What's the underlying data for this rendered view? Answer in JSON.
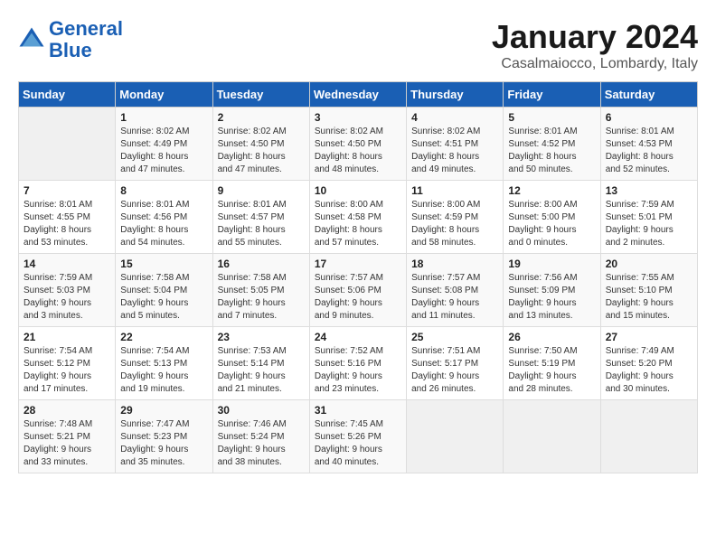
{
  "header": {
    "logo_line1": "General",
    "logo_line2": "Blue",
    "month": "January 2024",
    "location": "Casalmaiocco, Lombardy, Italy"
  },
  "weekdays": [
    "Sunday",
    "Monday",
    "Tuesday",
    "Wednesday",
    "Thursday",
    "Friday",
    "Saturday"
  ],
  "weeks": [
    [
      {
        "day": "",
        "info": ""
      },
      {
        "day": "1",
        "info": "Sunrise: 8:02 AM\nSunset: 4:49 PM\nDaylight: 8 hours\nand 47 minutes."
      },
      {
        "day": "2",
        "info": "Sunrise: 8:02 AM\nSunset: 4:50 PM\nDaylight: 8 hours\nand 47 minutes."
      },
      {
        "day": "3",
        "info": "Sunrise: 8:02 AM\nSunset: 4:50 PM\nDaylight: 8 hours\nand 48 minutes."
      },
      {
        "day": "4",
        "info": "Sunrise: 8:02 AM\nSunset: 4:51 PM\nDaylight: 8 hours\nand 49 minutes."
      },
      {
        "day": "5",
        "info": "Sunrise: 8:01 AM\nSunset: 4:52 PM\nDaylight: 8 hours\nand 50 minutes."
      },
      {
        "day": "6",
        "info": "Sunrise: 8:01 AM\nSunset: 4:53 PM\nDaylight: 8 hours\nand 52 minutes."
      }
    ],
    [
      {
        "day": "7",
        "info": "Sunrise: 8:01 AM\nSunset: 4:55 PM\nDaylight: 8 hours\nand 53 minutes."
      },
      {
        "day": "8",
        "info": "Sunrise: 8:01 AM\nSunset: 4:56 PM\nDaylight: 8 hours\nand 54 minutes."
      },
      {
        "day": "9",
        "info": "Sunrise: 8:01 AM\nSunset: 4:57 PM\nDaylight: 8 hours\nand 55 minutes."
      },
      {
        "day": "10",
        "info": "Sunrise: 8:00 AM\nSunset: 4:58 PM\nDaylight: 8 hours\nand 57 minutes."
      },
      {
        "day": "11",
        "info": "Sunrise: 8:00 AM\nSunset: 4:59 PM\nDaylight: 8 hours\nand 58 minutes."
      },
      {
        "day": "12",
        "info": "Sunrise: 8:00 AM\nSunset: 5:00 PM\nDaylight: 9 hours\nand 0 minutes."
      },
      {
        "day": "13",
        "info": "Sunrise: 7:59 AM\nSunset: 5:01 PM\nDaylight: 9 hours\nand 2 minutes."
      }
    ],
    [
      {
        "day": "14",
        "info": "Sunrise: 7:59 AM\nSunset: 5:03 PM\nDaylight: 9 hours\nand 3 minutes."
      },
      {
        "day": "15",
        "info": "Sunrise: 7:58 AM\nSunset: 5:04 PM\nDaylight: 9 hours\nand 5 minutes."
      },
      {
        "day": "16",
        "info": "Sunrise: 7:58 AM\nSunset: 5:05 PM\nDaylight: 9 hours\nand 7 minutes."
      },
      {
        "day": "17",
        "info": "Sunrise: 7:57 AM\nSunset: 5:06 PM\nDaylight: 9 hours\nand 9 minutes."
      },
      {
        "day": "18",
        "info": "Sunrise: 7:57 AM\nSunset: 5:08 PM\nDaylight: 9 hours\nand 11 minutes."
      },
      {
        "day": "19",
        "info": "Sunrise: 7:56 AM\nSunset: 5:09 PM\nDaylight: 9 hours\nand 13 minutes."
      },
      {
        "day": "20",
        "info": "Sunrise: 7:55 AM\nSunset: 5:10 PM\nDaylight: 9 hours\nand 15 minutes."
      }
    ],
    [
      {
        "day": "21",
        "info": "Sunrise: 7:54 AM\nSunset: 5:12 PM\nDaylight: 9 hours\nand 17 minutes."
      },
      {
        "day": "22",
        "info": "Sunrise: 7:54 AM\nSunset: 5:13 PM\nDaylight: 9 hours\nand 19 minutes."
      },
      {
        "day": "23",
        "info": "Sunrise: 7:53 AM\nSunset: 5:14 PM\nDaylight: 9 hours\nand 21 minutes."
      },
      {
        "day": "24",
        "info": "Sunrise: 7:52 AM\nSunset: 5:16 PM\nDaylight: 9 hours\nand 23 minutes."
      },
      {
        "day": "25",
        "info": "Sunrise: 7:51 AM\nSunset: 5:17 PM\nDaylight: 9 hours\nand 26 minutes."
      },
      {
        "day": "26",
        "info": "Sunrise: 7:50 AM\nSunset: 5:19 PM\nDaylight: 9 hours\nand 28 minutes."
      },
      {
        "day": "27",
        "info": "Sunrise: 7:49 AM\nSunset: 5:20 PM\nDaylight: 9 hours\nand 30 minutes."
      }
    ],
    [
      {
        "day": "28",
        "info": "Sunrise: 7:48 AM\nSunset: 5:21 PM\nDaylight: 9 hours\nand 33 minutes."
      },
      {
        "day": "29",
        "info": "Sunrise: 7:47 AM\nSunset: 5:23 PM\nDaylight: 9 hours\nand 35 minutes."
      },
      {
        "day": "30",
        "info": "Sunrise: 7:46 AM\nSunset: 5:24 PM\nDaylight: 9 hours\nand 38 minutes."
      },
      {
        "day": "31",
        "info": "Sunrise: 7:45 AM\nSunset: 5:26 PM\nDaylight: 9 hours\nand 40 minutes."
      },
      {
        "day": "",
        "info": ""
      },
      {
        "day": "",
        "info": ""
      },
      {
        "day": "",
        "info": ""
      }
    ]
  ]
}
